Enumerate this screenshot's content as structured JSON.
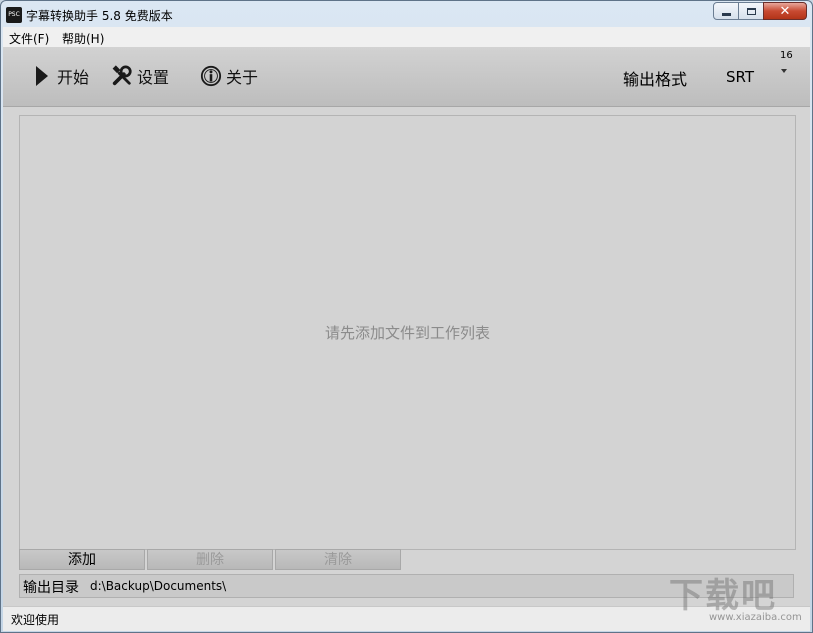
{
  "window": {
    "icon_text": "PSC",
    "title": "字幕转换助手 5.8 免费版本"
  },
  "menu": [
    "文件(F)",
    "帮助(H)"
  ],
  "toolbar": {
    "start_label": "开始",
    "settings_label": "设置",
    "about_label": "关于",
    "format_label": "输出格式",
    "format_value": "SRT",
    "format_badge": "16"
  },
  "list": {
    "empty_message": "请先添加文件到工作列表"
  },
  "actions": {
    "add": "添加",
    "delete": "删除",
    "clear": "清除"
  },
  "output": {
    "label": "输出目录",
    "path": "d:\\Backup\\Documents\\"
  },
  "status": {
    "text": "欢迎使用"
  },
  "watermark": {
    "text": "下载吧",
    "sub": "www.xiazaiba.com"
  }
}
